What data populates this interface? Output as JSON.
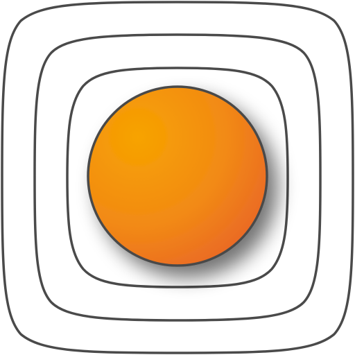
{
  "icon": {
    "name": "orange-circle-app-icon",
    "colors": {
      "background": "#ffffff",
      "outline": "#4a4a4a",
      "circle_light": "#f7a300",
      "circle_mid": "#f28a14",
      "circle_dark": "#e8612a",
      "shadow": "#000000"
    }
  }
}
